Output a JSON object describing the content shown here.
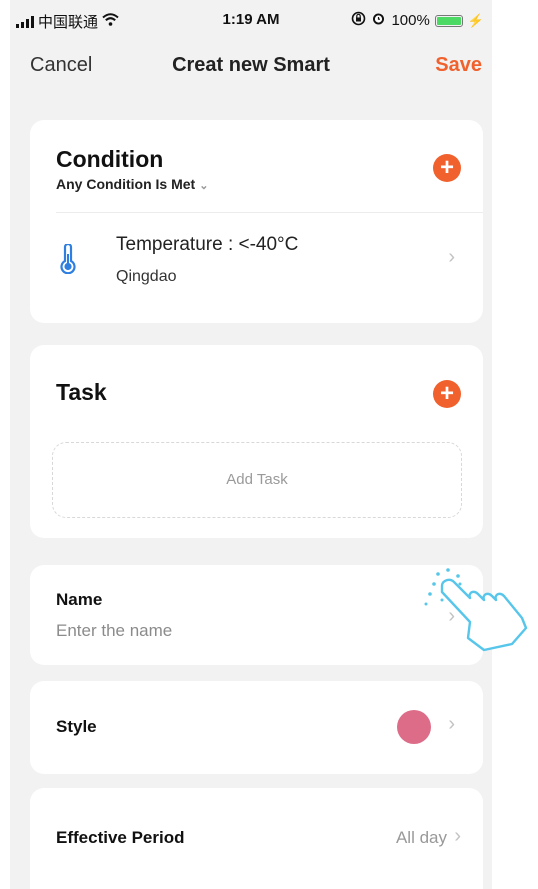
{
  "status_bar": {
    "carrier": "中国联通",
    "time": "1:19 AM",
    "battery": "100%",
    "battery_level": 1.0
  },
  "nav": {
    "cancel": "Cancel",
    "title": "Creat new Smart",
    "save": "Save"
  },
  "condition": {
    "title": "Condition",
    "mode": "Any Condition Is Met",
    "item": {
      "label": "Temperature : <-40°C",
      "location": "Qingdao"
    }
  },
  "task": {
    "title": "Task",
    "add_label": "Add Task"
  },
  "name_row": {
    "label": "Name",
    "placeholder": "Enter the name"
  },
  "style_row": {
    "label": "Style",
    "color": "#dd6c88"
  },
  "period_row": {
    "label": "Effective Period",
    "value": "All day"
  },
  "colors": {
    "accent": "#f0612d",
    "background": "#f2f2f2",
    "icon_blue": "#2f7fe0"
  }
}
